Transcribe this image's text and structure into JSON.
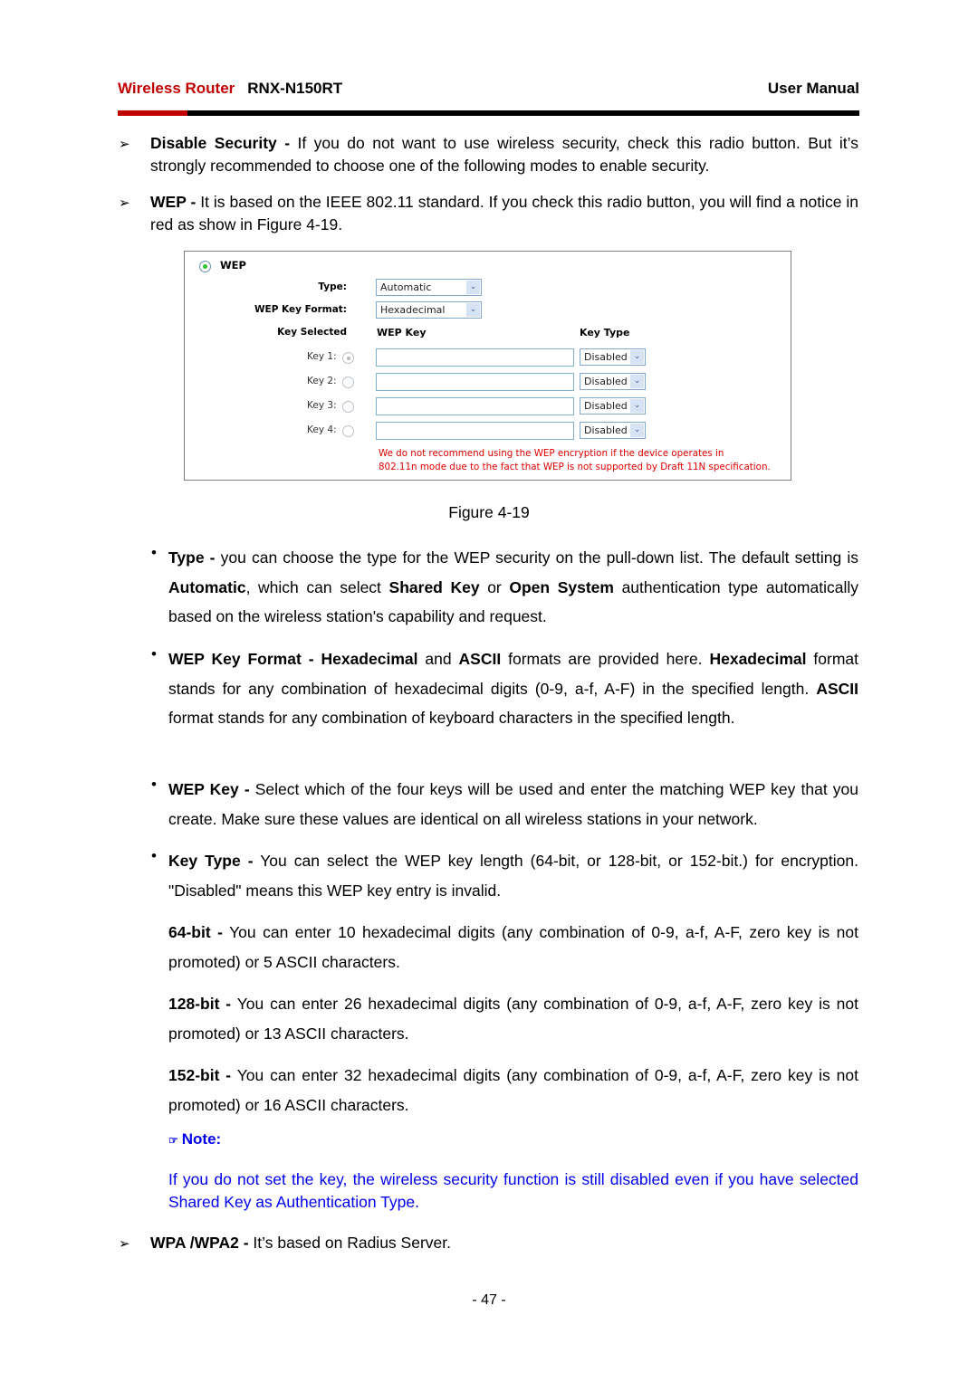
{
  "header": {
    "brand": "Wireless Router",
    "model": "RNX-N150RT",
    "doc_type": "User Manual",
    "accent_color": "#c00000"
  },
  "intro_items": [
    {
      "term": "Disable Security -",
      "text": " If you do not want to use wireless security, check this radio button. But it’s strongly recommended to choose one of the following modes to enable security."
    },
    {
      "term": "WEP -",
      "text": " It is based on the IEEE 802.11 standard. If you check this radio button, you will find a notice in red as show in Figure 4-19."
    }
  ],
  "figure": {
    "mode_label": "WEP",
    "type_label": "Type:",
    "type_value": "Automatic",
    "format_label": "WEP Key Format:",
    "format_value": "Hexadecimal",
    "col_key_selected": "Key Selected",
    "col_wep_key": "WEP Key",
    "col_key_type": "Key Type",
    "keys": [
      {
        "label": "Key 1:",
        "selected": true,
        "value": "",
        "type": "Disabled"
      },
      {
        "label": "Key 2:",
        "selected": false,
        "value": "",
        "type": "Disabled"
      },
      {
        "label": "Key 3:",
        "selected": false,
        "value": "",
        "type": "Disabled"
      },
      {
        "label": "Key 4:",
        "selected": false,
        "value": "",
        "type": "Disabled"
      }
    ],
    "warning_line1": "We do not recommend using the WEP encryption if the device operates in",
    "warning_line2": "802.11n mode due to the fact that WEP is not supported by Draft 11N specification.",
    "warning_color": "#e00000"
  },
  "caption": "Figure 4-19",
  "bullets": {
    "type": {
      "term": "Type -",
      "t1": " you can choose the type for the WEP security on the pull-down list. The default setting is ",
      "b1": "Automatic",
      "t2": ", which can select ",
      "b2": "Shared Key",
      "t3": " or ",
      "b3": "Open System",
      "t4": " authentication type automatically based on the wireless station's capability and request."
    },
    "format": {
      "term": "WEP Key Format -",
      "b1": " Hexadecimal",
      "t1": " and ",
      "b2": "ASCII",
      "t2": " formats are provided here. ",
      "b3": "Hexadecimal",
      "t3": " format stands for any combination of hexadecimal digits (0-9, a-f, A-F) in the specified length. ",
      "b4": "ASCII",
      "t4": " format stands for any combination of keyboard characters in the specified length."
    },
    "wepkey": {
      "term": "WEP Key -",
      "text": " Select which of the four keys will be used and enter the matching WEP key that you create. Make sure these values are identical on all wireless stations in your network."
    },
    "keytype": {
      "term": "Key Type -",
      "text": " You can select the WEP key length (64-bit, or 128-bit, or 152-bit.) for encryption. \"Disabled\" means this WEP key entry is invalid."
    }
  },
  "bit_items": [
    {
      "term": "64-bit -",
      "text": " You can enter 10 hexadecimal digits (any combination of 0-9, a-f, A-F, zero key is not promoted) or 5 ASCII characters."
    },
    {
      "term": "128-bit -",
      "text": " You can enter 26 hexadecimal digits (any combination of 0-9, a-f, A-F, zero key is not promoted) or 13 ASCII characters."
    },
    {
      "term": "152-bit -",
      "text": " You can enter 32 hexadecimal digits (any combination of 0-9, a-f, A-F, zero key is not promoted) or 16 ASCII characters."
    }
  ],
  "note": {
    "icon": "pointing-hand-icon",
    "glyph": "☞",
    "title": "Note:",
    "text": "If you do not set the key, the wireless security function is still disabled even if you have selected Shared Key as Authentication Type.",
    "color": "#0000ee"
  },
  "final_item": {
    "term": "WPA /WPA2 -",
    "text": " It’s based on Radius Server."
  },
  "page_number": "- 47 -",
  "glyphs": {
    "arrow": "➢",
    "bullet": "•",
    "chevron": "⌄"
  }
}
